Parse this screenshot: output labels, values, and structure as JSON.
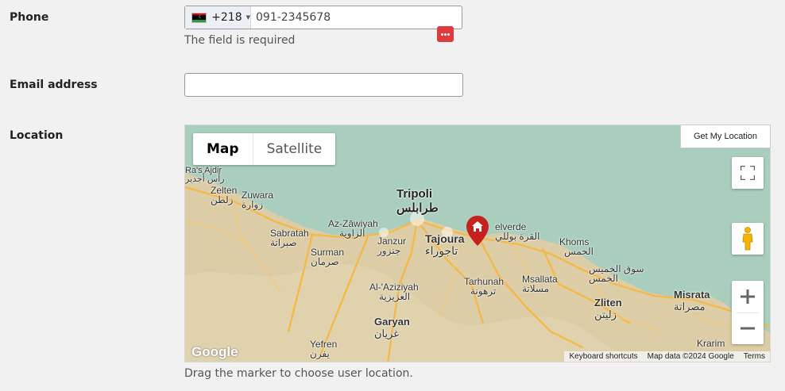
{
  "form": {
    "phone_label": "Phone",
    "phone_dial_code": "+218",
    "phone_value": "091-2345678",
    "phone_error": "The field is required",
    "email_label": "Email address",
    "email_value": "",
    "location_label": "Location",
    "location_hint": "Drag the marker to choose user location."
  },
  "map": {
    "type_map": "Map",
    "type_satellite": "Satellite",
    "get_location": "Get My Location",
    "logo": "Google",
    "attribution": [
      "Keyboard shortcuts",
      "Map data ©2024 Google",
      "Terms"
    ],
    "places": {
      "rasajdir": "Ra's Ajdir",
      "rasajdir_ar": "رأس أجدير",
      "zelten": "Zelten",
      "zelten_ar": "زلطن",
      "zuwara": "Zuwara",
      "zuwara_ar": "زوارة",
      "sabratah": "Sabratah",
      "sabratah_ar": "صبراتة",
      "surman": "Surman",
      "surman_ar": "صرمان",
      "azzawiyah": "Az-Zāwiyah",
      "azzawiyah_ar": "الزاوية",
      "janzur": "Janzur",
      "janzur_ar": "جنزور",
      "tripoli": "Tripoli",
      "tripoli_ar": "طرابلس",
      "tajoura": "Tajoura",
      "tajoura_ar": "تاجوراء",
      "castelverde": "elverde",
      "castelverde_ar": "القرة بوللي",
      "alaziziyah": "Al-'Aziziyah",
      "alaziziyah_ar": "العزيزية",
      "tarhunah": "Tarhunah",
      "tarhunah_ar": "ترهونة",
      "msallata": "Msallata",
      "msallata_ar": "مسلاتة",
      "khoms": "Khoms",
      "khoms_ar": "الخمس",
      "souq": "سوق الخميس",
      "souq2": "الخمس",
      "zliten": "Zliten",
      "zliten_ar": "زليتن",
      "misrata": "Misrata",
      "misrata_ar": "مصراتة",
      "garyan": "Garyan",
      "garyan_ar": "غريان",
      "yefren": "Yefren",
      "yefren_ar": "يفرن",
      "krarim": "Krarim"
    },
    "colors": {
      "sea": "#aacebd",
      "land": "#dccda6",
      "road": "#f5b84a",
      "marker": "#c5221f"
    }
  }
}
